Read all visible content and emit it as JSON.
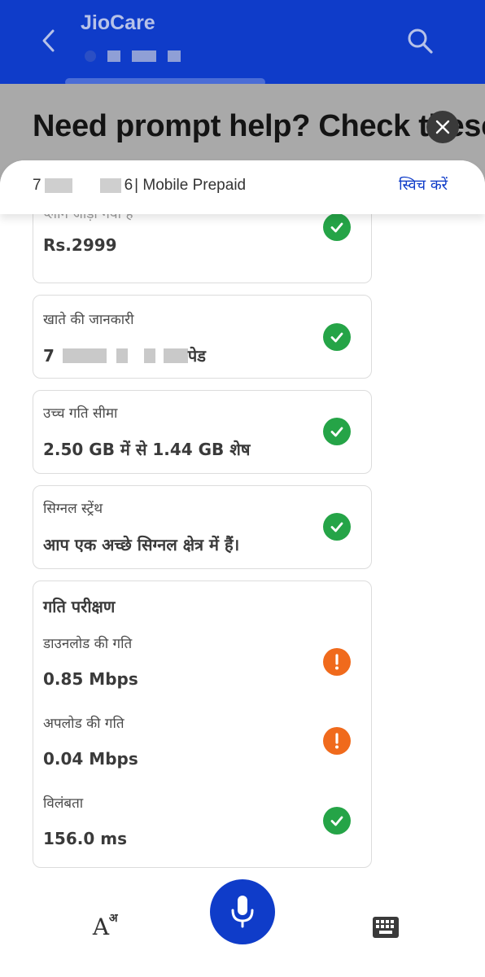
{
  "app": {
    "title": "JioCare",
    "prompt_heading": "Need prompt help? Check these options",
    "colors": {
      "header_blue": "#0f3cc9",
      "ok_green": "#25a447",
      "warn_orange": "#f06a1c"
    }
  },
  "account": {
    "number_start": "7",
    "number_end": "6",
    "plan_type": "| Mobile Prepaid",
    "switch_label": "स्विच करें"
  },
  "cards": {
    "plan": {
      "label": "प्लान जोड़ा गया है",
      "value": "Rs.2999",
      "status": "ok"
    },
    "account_info": {
      "label": "खाते की जानकारी",
      "value_start": "7",
      "value_end": "पेड",
      "status": "ok"
    },
    "high_speed": {
      "label": "उच्च गति सीमा",
      "value": "2.50 GB में से 1.44 GB शेष",
      "status": "ok"
    },
    "signal": {
      "label": "सिग्नल स्ट्रेंथ",
      "value": "आप एक अच्छे सिग्नल क्षेत्र में हैं।",
      "status": "ok"
    },
    "speed_test": {
      "title": "गति परीक्षण",
      "download": {
        "label": "डाउनलोड की गति",
        "value": "0.85 Mbps",
        "status": "warn"
      },
      "upload": {
        "label": "अपलोड की गति",
        "value": "0.04 Mbps",
        "status": "warn"
      },
      "latency": {
        "label": "विलंबता",
        "value": "156.0 ms",
        "status": "ok"
      }
    }
  },
  "bottom_bar": {
    "lang_icon": "A",
    "lang_icon_sup": "अ",
    "icons": [
      "language-icon",
      "microphone-icon",
      "keyboard-icon"
    ]
  }
}
